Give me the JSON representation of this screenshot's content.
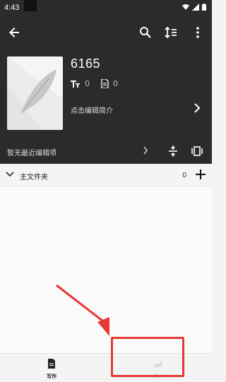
{
  "status_bar": {
    "time": "4:43",
    "icons": [
      "wifi-icon",
      "signal-icon",
      "battery-icon"
    ]
  },
  "app_bar": {
    "back_icon": "arrow-left-icon",
    "search_icon": "search-icon",
    "sort_icon": "sort-icon",
    "more_icon": "more-vert-icon"
  },
  "book": {
    "title": "6165",
    "word_count": "0",
    "chapter_count": "0",
    "description_prompt": "点击编辑简介"
  },
  "recent": {
    "text": "暂无最近编辑项"
  },
  "folder": {
    "name": "主文件夹",
    "count": "0"
  },
  "bottom_nav": {
    "write_label": "写作",
    "stats_label": "统计"
  },
  "colors": {
    "header_bg": "#2b2b2b",
    "page_bg": "#f4f4f4",
    "annotation_red": "#e53935"
  }
}
